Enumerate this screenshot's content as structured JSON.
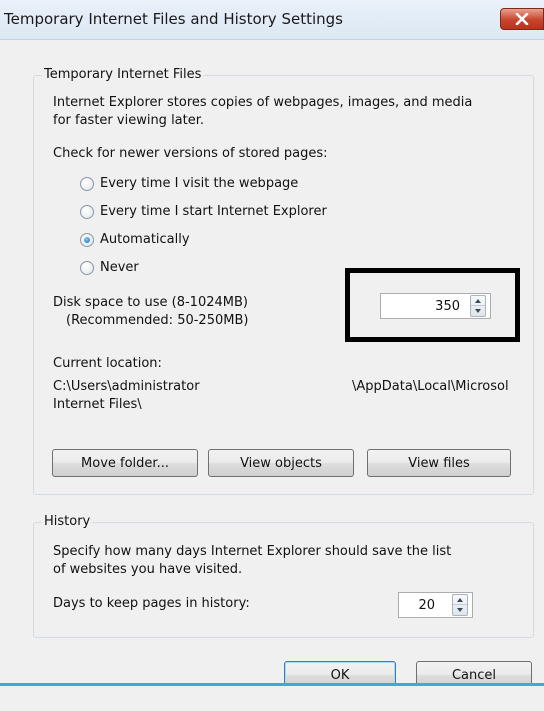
{
  "window": {
    "title": "Temporary Internet Files and History Settings"
  },
  "temp_files": {
    "group_label": "Temporary Internet Files",
    "desc_line1": "Internet Explorer stores copies of webpages, images, and media",
    "desc_line2": "for faster viewing later.",
    "check_label": "Check for newer versions of stored pages:",
    "options": [
      {
        "label": "Every time I visit the webpage",
        "selected": false
      },
      {
        "label": "Every time I start Internet Explorer",
        "selected": false
      },
      {
        "label": "Automatically",
        "selected": true
      },
      {
        "label": "Never",
        "selected": false
      }
    ],
    "disk_label_line1": "Disk space to use (8-1024MB)",
    "disk_label_line2": "(Recommended: 50-250MB)",
    "disk_value": "350",
    "location_label": "Current location:",
    "location_line1_left": "C:\\Users\\administrator",
    "location_line1_right": "\\AppData\\Local\\Microsol",
    "location_line2": "Internet Files\\",
    "buttons": {
      "move_folder": "Move folder...",
      "view_objects": "View objects",
      "view_files": "View files"
    }
  },
  "history": {
    "group_label": "History",
    "desc_line1": "Specify how many days Internet Explorer should save the list",
    "desc_line2": "of websites you have visited.",
    "days_label": "Days to keep pages in history:",
    "days_value": "20"
  },
  "dialog_buttons": {
    "ok": "OK",
    "cancel": "Cancel"
  },
  "colors": {
    "close_button": "#c9442c",
    "highlight_box": "#000000",
    "focus_accent": "#3fa9d6"
  }
}
